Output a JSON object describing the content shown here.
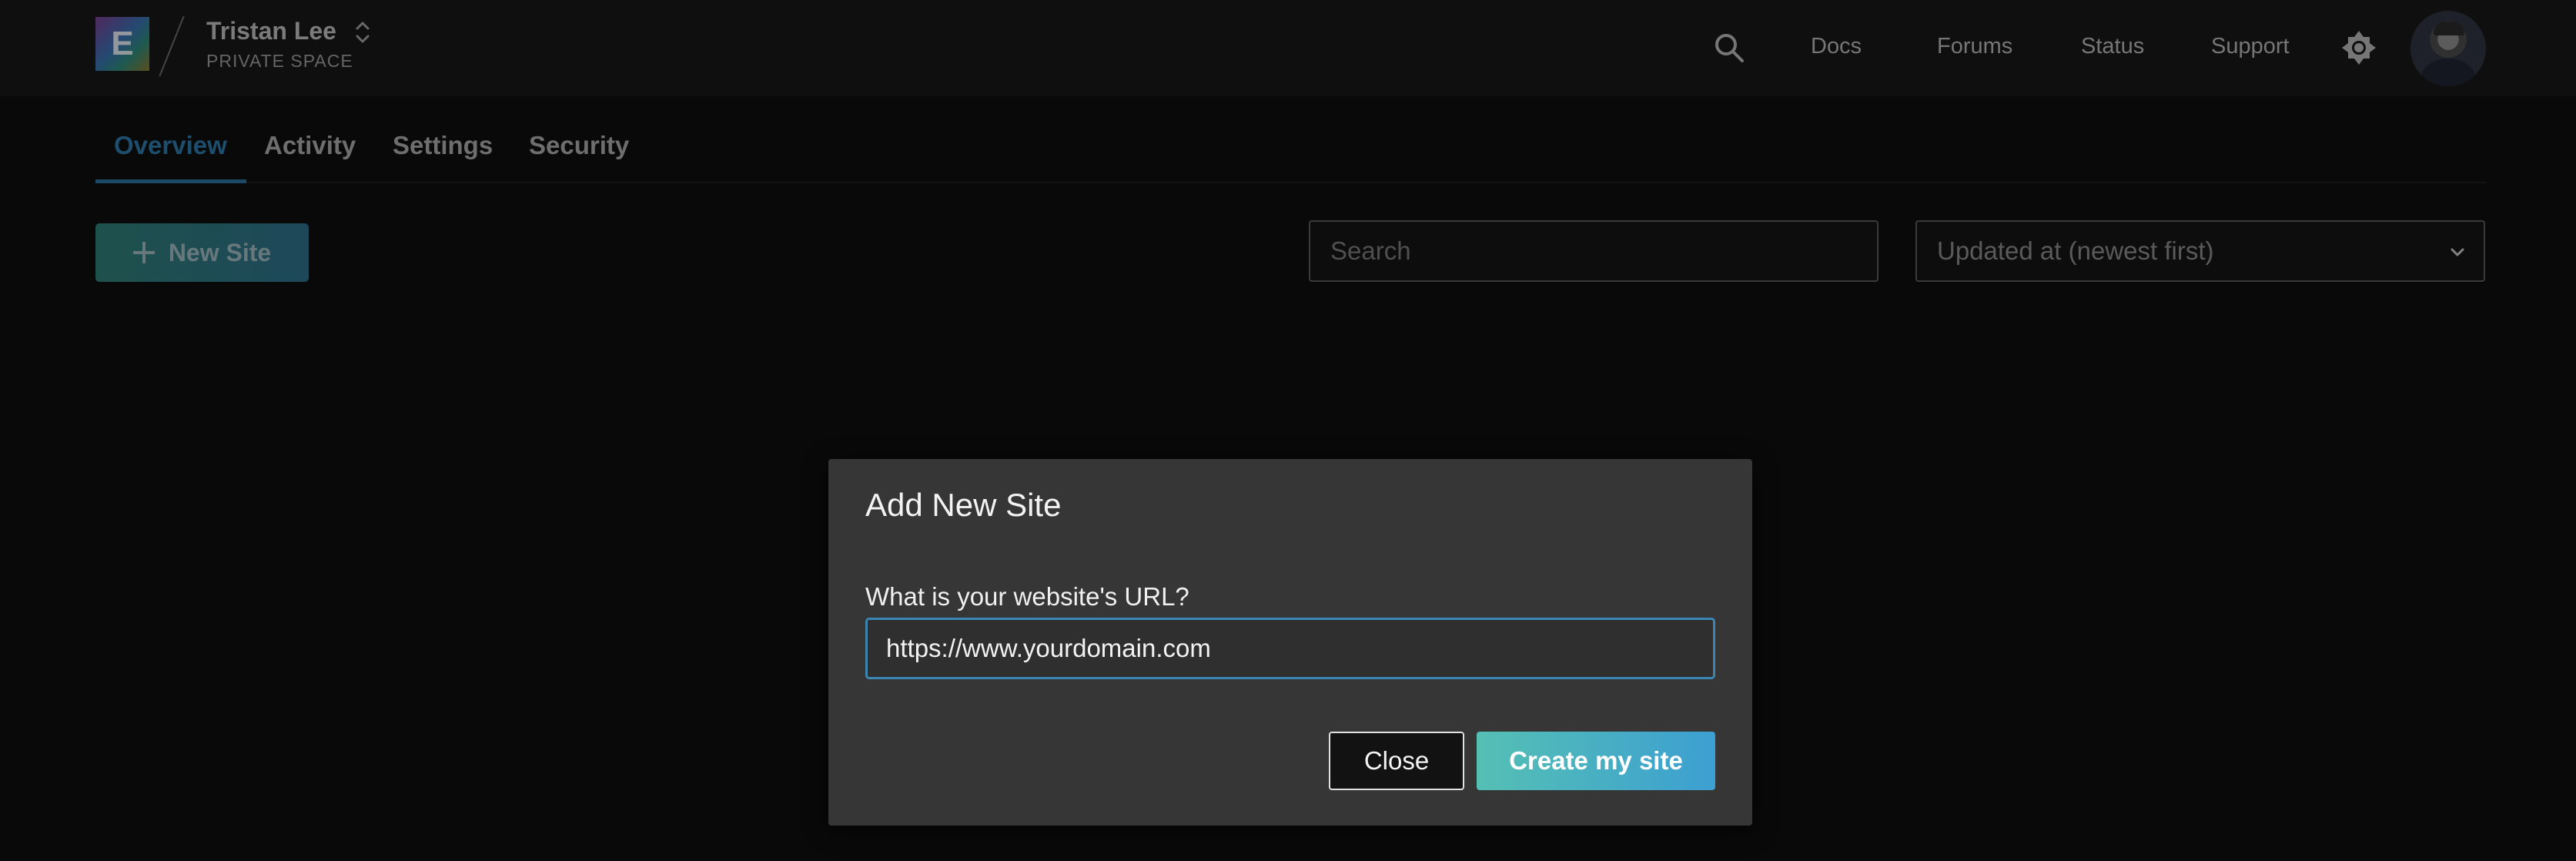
{
  "header": {
    "logo_letter": "E",
    "space_name": "Tristan Lee",
    "space_subtitle": "PRIVATE SPACE",
    "nav_links": [
      "Docs",
      "Forums",
      "Status",
      "Support"
    ],
    "icons": {
      "search": "search-icon",
      "space_toggle": "chevron-up-down-icon",
      "theme": "sun-icon"
    }
  },
  "tabs": [
    {
      "label": "Overview",
      "active": true
    },
    {
      "label": "Activity",
      "active": false
    },
    {
      "label": "Settings",
      "active": false
    },
    {
      "label": "Security",
      "active": false
    }
  ],
  "toolbar": {
    "new_site_label": "New Site",
    "search_placeholder": "Search",
    "sort_selected": "Updated at (newest first)"
  },
  "modal": {
    "title": "Add New Site",
    "url_label": "What is your website's URL?",
    "url_value": "https://www.yourdomain.com",
    "close_label": "Close",
    "create_label": "Create my site"
  },
  "colors": {
    "accent": "#2f79a8",
    "primary_gradient_start": "#55c0b4",
    "primary_gradient_end": "#3c9fd2",
    "background": "#0e0e0e"
  }
}
